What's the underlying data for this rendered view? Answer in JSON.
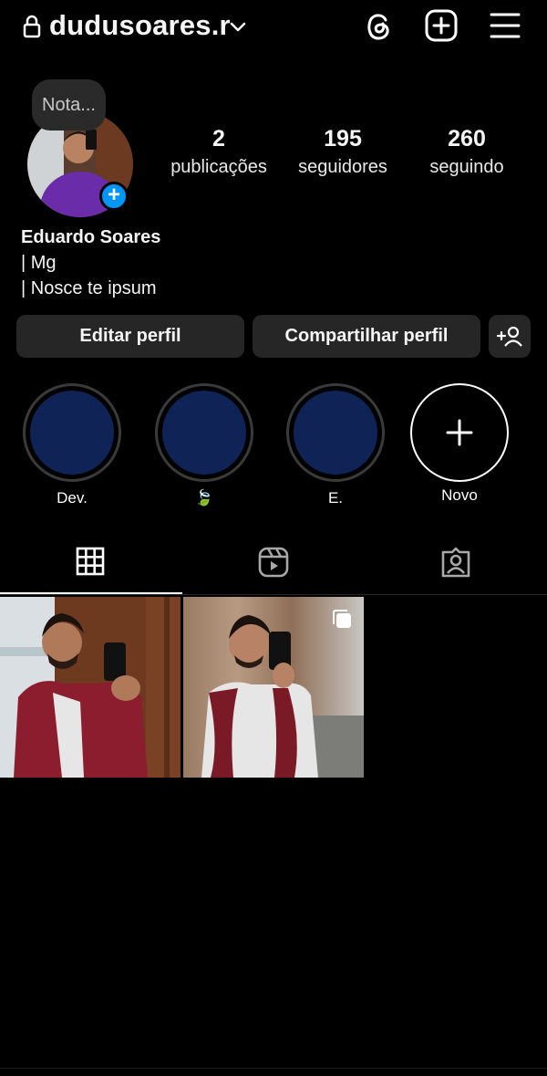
{
  "header": {
    "username": "dudusoares.r",
    "icons": [
      "lock-icon",
      "chevron-down-icon",
      "threads-icon",
      "create-post-icon",
      "menu-icon"
    ]
  },
  "profile": {
    "note": "Nota...",
    "stats": [
      {
        "value": "2",
        "label": "publicações"
      },
      {
        "value": "195",
        "label": "seguidores"
      },
      {
        "value": "260",
        "label": "seguindo"
      }
    ],
    "name": "Eduardo Soares",
    "bio_lines": [
      "| Mg",
      "| Nosce te ipsum"
    ]
  },
  "actions": {
    "edit": "Editar perfil",
    "share": "Compartilhar perfil"
  },
  "highlights": [
    {
      "label": "Dev."
    },
    {
      "label": "🍃"
    },
    {
      "label": "E."
    },
    {
      "label": "Novo"
    }
  ],
  "tabs": [
    "grid-icon",
    "reels-icon",
    "tagged-icon"
  ],
  "colors": {
    "background": "#000000",
    "button": "#262626",
    "accent_blue": "#0095f6",
    "highlight_fill": "#0f2356"
  }
}
